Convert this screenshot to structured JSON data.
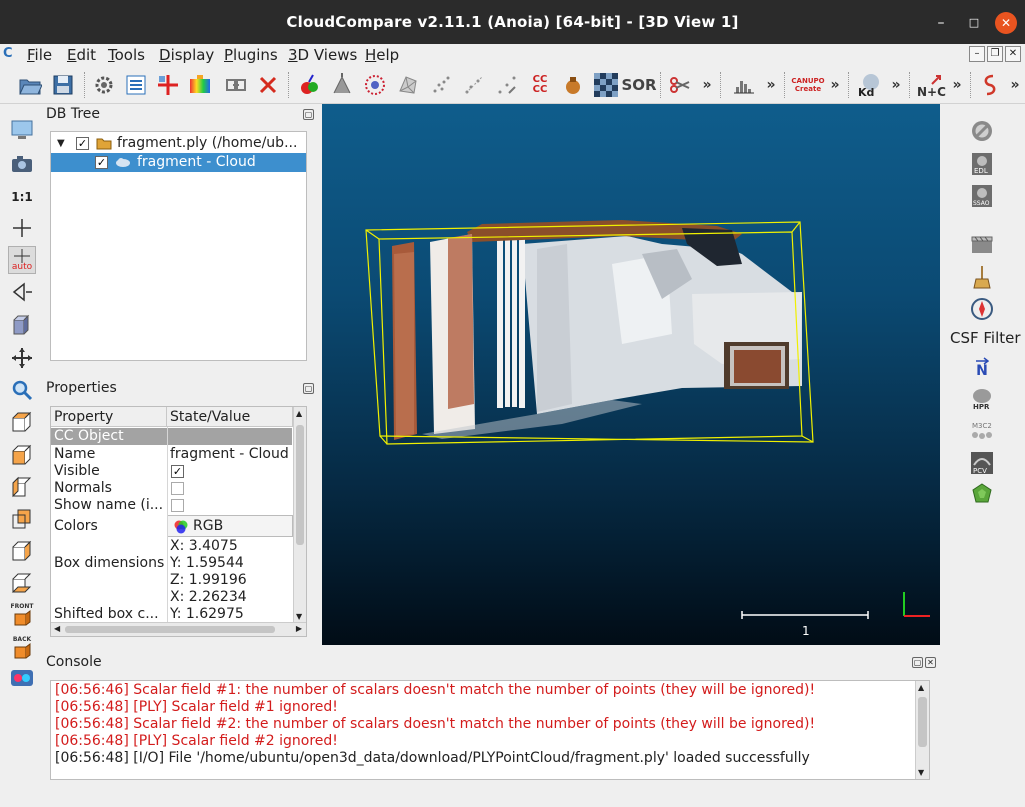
{
  "window": {
    "title": "CloudCompare v2.11.1 (Anoia) [64-bit] - [3D View 1]",
    "minimize": "–",
    "maximize": "□",
    "close": "✕"
  },
  "menu": {
    "app_icon": "C",
    "items": [
      "File",
      "Edit",
      "Tools",
      "Display",
      "Plugins",
      "3D Views",
      "Help"
    ]
  },
  "toolbar": {
    "sor_label": "SOR",
    "cccc_label": "CC\nCC",
    "kd_label": "Kd",
    "nc_label": "N+C",
    "canupo_label": "CANUPO Create",
    "more": "»"
  },
  "left_toolbar": {
    "scale_label": "1:1",
    "auto_label": "auto",
    "front_label": "FRONT",
    "back_label": "BACK"
  },
  "right_toolbar": {
    "csf_label": "CSF Filter",
    "edl_label": "EDL",
    "ssao_label": "SSAO",
    "hpr_label": "HPR",
    "m3c2_label": "M3C2",
    "pcv_label": "PCV",
    "n_label": "N"
  },
  "db_tree": {
    "title": "DB Tree",
    "items": [
      {
        "label": "fragment.ply (/home/ub...",
        "checked": "✓"
      },
      {
        "label": "fragment - Cloud",
        "checked": "✓"
      }
    ]
  },
  "properties": {
    "title": "Properties",
    "headers": [
      "Property",
      "State/Value"
    ],
    "group": "CC Object",
    "rows": [
      {
        "name": "Name",
        "value": "fragment - Cloud"
      },
      {
        "name": "Visible",
        "value": "✓"
      },
      {
        "name": "Normals",
        "value": ""
      },
      {
        "name": "Show name (i...",
        "value": ""
      },
      {
        "name": "Colors",
        "value": "RGB"
      },
      {
        "name": "Box dimensions",
        "values": [
          "X: 3.4075",
          "Y: 1.59544",
          "Z: 1.99196"
        ]
      },
      {
        "name": "Shifted box c...",
        "values": [
          "X: 2.26234",
          "Y: 1.62975"
        ]
      }
    ]
  },
  "view3d": {
    "scale_label": "1"
  },
  "console": {
    "title": "Console",
    "lines": [
      {
        "text": "[06:56:46] Scalar field #1: the number of scalars doesn't match the number of points (they will be ignored)!",
        "type": "err"
      },
      {
        "text": "[06:56:48] [PLY] Scalar field #1 ignored!",
        "type": "err"
      },
      {
        "text": "[06:56:48] Scalar field #2: the number of scalars doesn't match the number of points (they will be ignored)!",
        "type": "err"
      },
      {
        "text": "[06:56:48] [PLY] Scalar field #2 ignored!",
        "type": "err"
      },
      {
        "text": "[06:56:48] [I/O] File '/home/ubuntu/open3d_data/download/PLYPointCloud/fragment.ply' loaded successfully",
        "type": "ok"
      }
    ]
  },
  "colors": {
    "titlebar": "#2b2b2b",
    "close_button": "#e95420",
    "selection": "#3d8fce",
    "error_text": "#d31c1c",
    "bbox": "#f0f000"
  }
}
